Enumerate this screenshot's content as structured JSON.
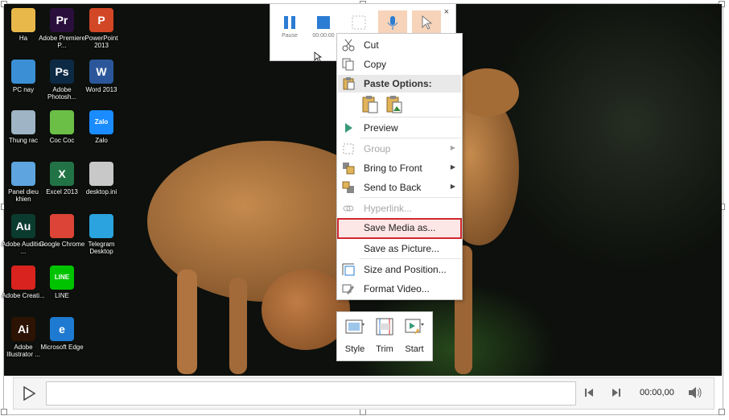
{
  "desktop_icons": [
    {
      "label": "Ha",
      "glyph": "",
      "color": "#e9b84a"
    },
    {
      "label": "Adobe Premiere P...",
      "glyph": "Pr",
      "color": "#2a0f3d"
    },
    {
      "label": "PowerPoint 2013",
      "glyph": "P",
      "color": "#d24726"
    },
    {
      "label": "PC nay",
      "glyph": "",
      "color": "#3b8fd4"
    },
    {
      "label": "Adobe Photosh...",
      "glyph": "Ps",
      "color": "#0d2a44"
    },
    {
      "label": "Word 2013",
      "glyph": "W",
      "color": "#2b579a"
    },
    {
      "label": "Thung rac",
      "glyph": "",
      "color": "#9fb4c4"
    },
    {
      "label": "Coc Coc",
      "glyph": "",
      "color": "#6bbf46"
    },
    {
      "label": "Zalo",
      "glyph": "Zalo",
      "color": "#1a8cff"
    },
    {
      "label": "Panel dieu khien",
      "glyph": "",
      "color": "#5ea5e0"
    },
    {
      "label": "Excel 2013",
      "glyph": "X",
      "color": "#217346"
    },
    {
      "label": "desktop.ini",
      "glyph": "",
      "color": "#c8c8c8"
    },
    {
      "label": "Adobe Audition ...",
      "glyph": "Au",
      "color": "#0b3b2f"
    },
    {
      "label": "Google Chrome",
      "glyph": "",
      "color": "#db4437"
    },
    {
      "label": "Telegram Desktop",
      "glyph": "",
      "color": "#2aa3df"
    },
    {
      "label": "Adobe Creati...",
      "glyph": "",
      "color": "#d8231f"
    },
    {
      "label": "LINE",
      "glyph": "LINE",
      "color": "#00c300"
    },
    {
      "label": "Adobe Illustrator ...",
      "glyph": "Ai",
      "color": "#2d1303"
    },
    {
      "label": "Microsoft Edge",
      "glyph": "e",
      "color": "#1e7ad0"
    }
  ],
  "recording_toolbar": {
    "pause_label": "Pause",
    "stop_label": "00:00:00",
    "close_glyph": "×"
  },
  "context_menu": {
    "items": {
      "cut": "Cut",
      "copy": "Copy",
      "paste_options": "Paste Options:",
      "preview": "Preview",
      "group": "Group",
      "bring_to_front": "Bring to Front",
      "send_to_back": "Send to Back",
      "hyperlink": "Hyperlink...",
      "save_media_as": "Save Media as...",
      "save_as_picture": "Save as Picture...",
      "size_and_position": "Size and Position...",
      "format_video": "Format Video..."
    }
  },
  "mini_toolbar": {
    "style_label": "Style",
    "trim_label": "Trim",
    "start_label": "Start"
  },
  "player": {
    "time": "00:00,00",
    "progress": 0
  },
  "colors": {
    "highlight_border": "#d0272e",
    "accent": "#2b7cd3"
  }
}
